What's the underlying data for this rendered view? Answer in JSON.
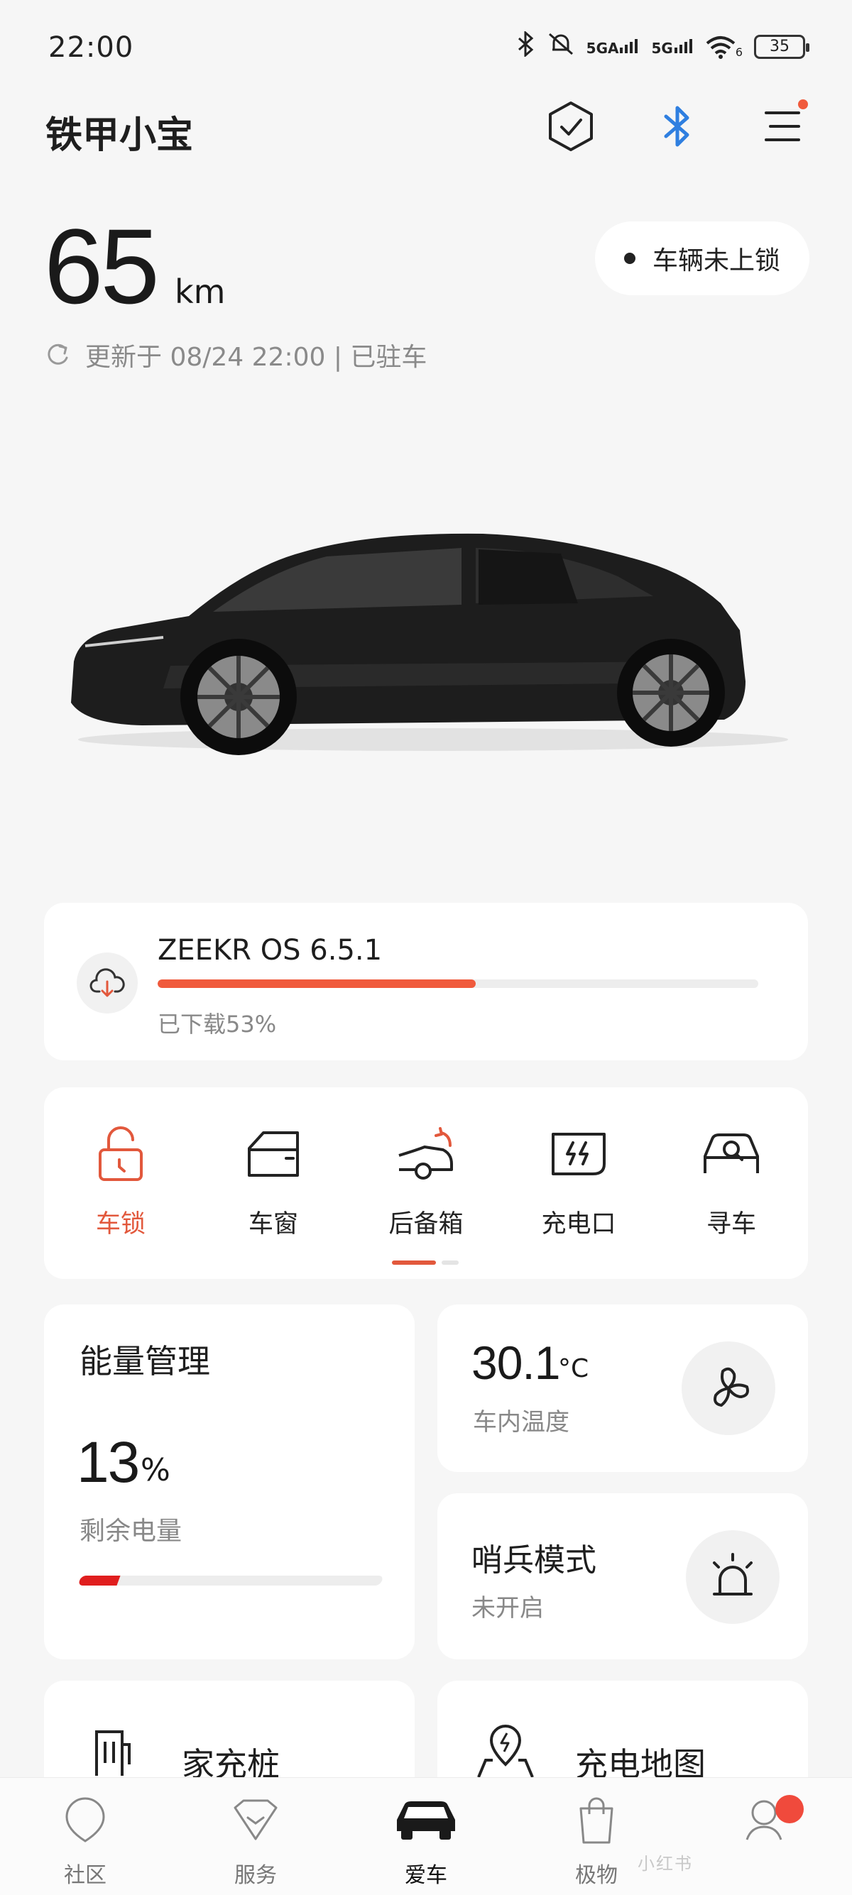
{
  "status_bar": {
    "time": "22:00",
    "signal_1": "5GA",
    "signal_2": "5G",
    "wifi_sub": "6",
    "battery_level": "35"
  },
  "header": {
    "title": "铁甲小宝"
  },
  "vehicle": {
    "range_value": "65",
    "range_unit": "km",
    "updated_text": "更新于 08/24 22:00 | 已驻车",
    "lock_status": "车辆未上锁"
  },
  "ota": {
    "title": "ZEEKR OS 6.5.1",
    "progress_text": "已下载53%",
    "progress": 0.53
  },
  "controls": [
    {
      "label": "车锁",
      "icon": "lock-icon",
      "active": true
    },
    {
      "label": "车窗",
      "icon": "window-icon",
      "active": false
    },
    {
      "label": "后备箱",
      "icon": "trunk-icon",
      "active": false
    },
    {
      "label": "充电口",
      "icon": "charge-port-icon",
      "active": false
    },
    {
      "label": "寻车",
      "icon": "find-car-icon",
      "active": false
    }
  ],
  "energy": {
    "title": "能量管理",
    "battery_percent": "13",
    "unit": "%",
    "label": "剩余电量",
    "level": 0.13,
    "bar_color": "#e01e1e"
  },
  "climate": {
    "temperature": "30.1",
    "unit": "°C",
    "label": "车内温度"
  },
  "sentry": {
    "title": "哨兵模式",
    "status": "未开启"
  },
  "tiles": {
    "home_charger": "家充桩",
    "charging_map": "充电地图"
  },
  "bottom_nav": [
    {
      "label": "社区",
      "icon": "community-icon",
      "active": false
    },
    {
      "label": "服务",
      "icon": "service-icon",
      "active": false
    },
    {
      "label": "爱车",
      "icon": "car-icon",
      "active": true
    },
    {
      "label": "极物",
      "icon": "shop-bag-icon",
      "active": false
    },
    {
      "label": "",
      "icon": "profile-icon",
      "active": false,
      "badge": true
    }
  ],
  "watermark": "小红书",
  "colors": {
    "accent": "#f05a3c",
    "background": "#f6f6f6"
  }
}
